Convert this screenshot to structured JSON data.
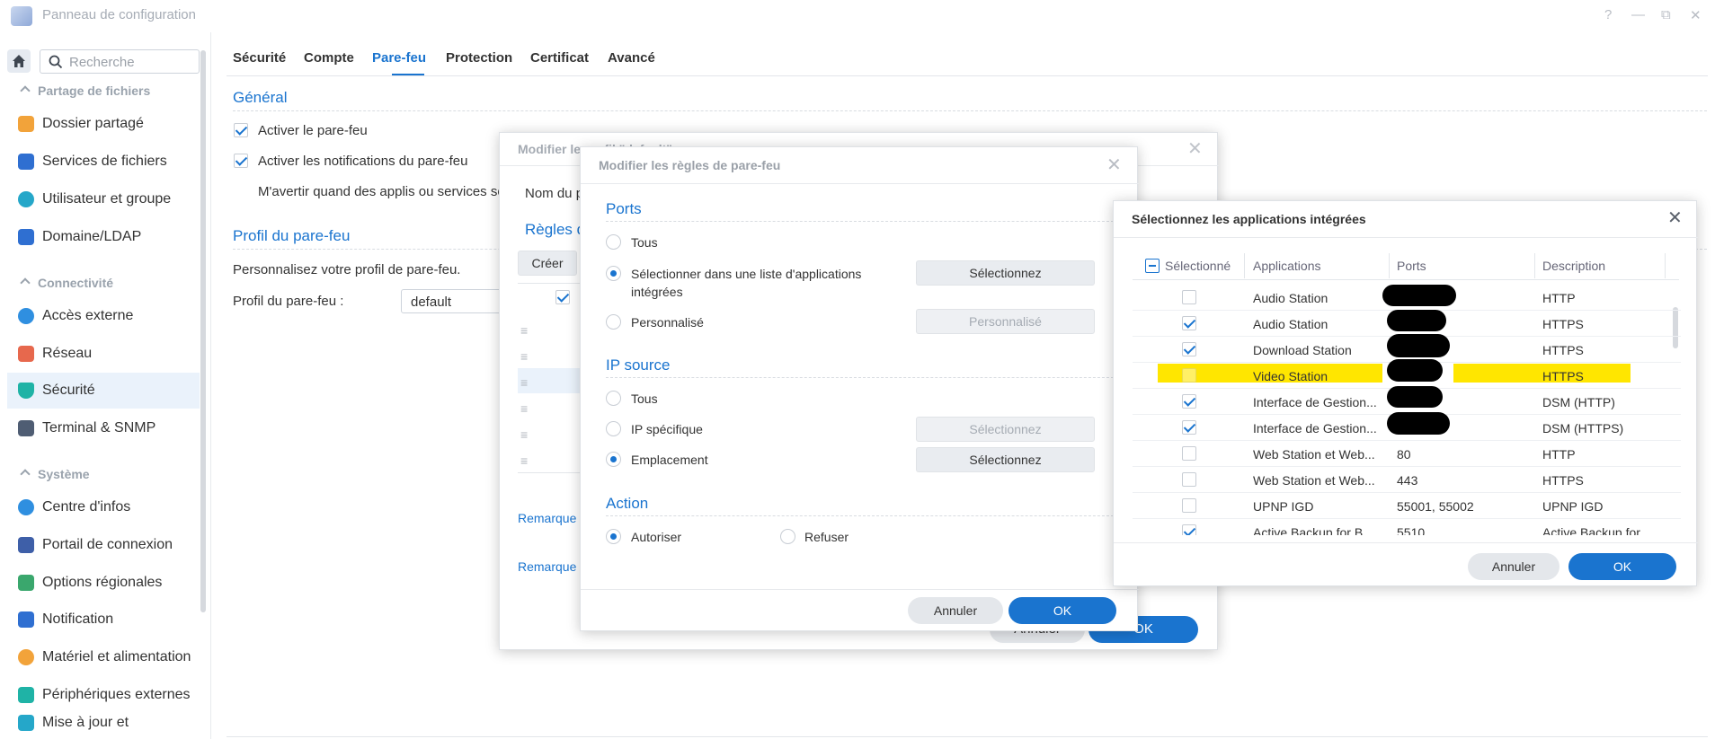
{
  "window": {
    "title": "Panneau de configuration",
    "controls": [
      "?",
      "—",
      "⧉",
      "✕"
    ]
  },
  "sidebar": {
    "search_placeholder": "Recherche",
    "sections": [
      {
        "label": "Partage de fichiers",
        "items": [
          "Dossier partagé",
          "Services de fichiers",
          "Utilisateur et groupe",
          "Domaine/LDAP"
        ]
      },
      {
        "label": "Connectivité",
        "items": [
          "Accès externe",
          "Réseau",
          "Sécurité",
          "Terminal & SNMP"
        ]
      },
      {
        "label": "Système",
        "items": [
          "Centre d'infos",
          "Portail de connexion",
          "Options régionales",
          "Notification",
          "Matériel et alimentation",
          "Périphériques externes",
          "Mise à jour et"
        ]
      }
    ],
    "active_item": "Sécurité"
  },
  "tabs": [
    "Sécurité",
    "Compte",
    "Pare-feu",
    "Protection",
    "Certificat",
    "Avancé"
  ],
  "active_tab": "Pare-feu",
  "general": {
    "heading": "Général",
    "enable_firewall": "Activer le pare-feu",
    "enable_notifications": "Activer les notifications du pare-feu",
    "notify_text": "M'avertir quand des applis ou services so"
  },
  "profile": {
    "heading": "Profil du pare-feu",
    "desc": "Personnalisez votre profil de pare-feu.",
    "label": "Profil du pare-feu :",
    "value": "default"
  },
  "dialog_profile": {
    "title": "Modifier le profil \"default\"",
    "name_label": "Nom du p",
    "rules_heading": "Règles d",
    "create_btn": "Créer",
    "remark1": "Remarque",
    "remark2": "Remarque",
    "cancel": "Annuler",
    "ok": "OK"
  },
  "dialog_rules": {
    "title": "Modifier les règles de pare-feu",
    "ports_heading": "Ports",
    "ports_all": "Tous",
    "ports_list": "Sélectionner dans une liste d'applications",
    "ports_list2": "intégrées",
    "ports_custom": "Personnalisé",
    "btn_select": "Sélectionnez",
    "btn_custom": "Personnalisé",
    "ip_heading": "IP source",
    "ip_all": "Tous",
    "ip_specific": "IP spécifique",
    "ip_location": "Emplacement",
    "action_heading": "Action",
    "allow": "Autoriser",
    "deny": "Refuser",
    "cancel": "Annuler",
    "ok": "OK"
  },
  "dialog_apps": {
    "title": "Sélectionnez les applications intégrées",
    "headers": [
      "Sélectionné",
      "Applications",
      "Ports",
      "Description"
    ],
    "rows": [
      {
        "checked": false,
        "app": "Audio Station",
        "ports": "",
        "desc": "HTTP"
      },
      {
        "checked": true,
        "app": "Audio Station",
        "ports": "",
        "desc": "HTTPS"
      },
      {
        "checked": true,
        "app": "Download Station",
        "ports": "",
        "desc": "HTTPS"
      },
      {
        "checked": false,
        "app": "Video Station",
        "ports": "",
        "desc": "HTTPS"
      },
      {
        "checked": true,
        "app": "Interface de Gestion...",
        "ports": "",
        "desc": "DSM (HTTP)"
      },
      {
        "checked": true,
        "app": "Interface de Gestion...",
        "ports": "",
        "desc": "DSM (HTTPS)"
      },
      {
        "checked": false,
        "app": "Web Station et Web...",
        "ports": "80",
        "desc": "HTTP"
      },
      {
        "checked": false,
        "app": "Web Station et Web...",
        "ports": "443",
        "desc": "HTTPS"
      },
      {
        "checked": false,
        "app": "UPNP IGD",
        "ports": "55001, 55002",
        "desc": "UPNP IGD"
      },
      {
        "checked": true,
        "app": "Active Backup for B...",
        "ports": "5510",
        "desc": "Active Backup for..."
      }
    ],
    "cancel": "Annuler",
    "ok": "OK"
  }
}
